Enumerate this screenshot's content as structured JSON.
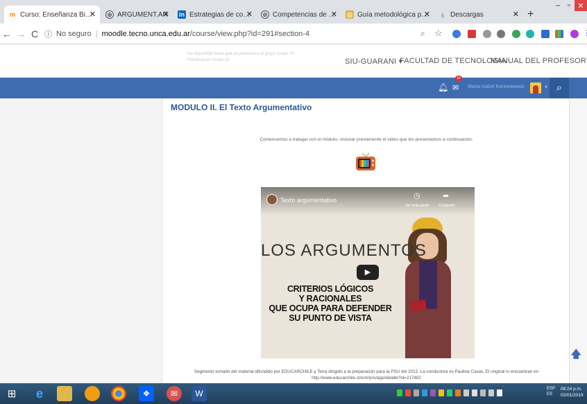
{
  "browser": {
    "tabs": [
      {
        "label": "Curso: Enseñanza Bimod",
        "icon": "moodle-icon",
        "active": true
      },
      {
        "label": "ARGUMENT.AR",
        "icon": "globe-icon"
      },
      {
        "label": "Estrategias de compresi",
        "icon": "linkedin-icon"
      },
      {
        "label": "Competencias de Educac",
        "icon": "globe-icon"
      },
      {
        "label": "Guía metodológica para",
        "icon": "document-icon"
      },
      {
        "label": "Descargas",
        "icon": "download-icon"
      }
    ],
    "url_security": "No seguro",
    "url_host": "moodle.tecno.unca.edu.ar",
    "url_path": "/course/view.php?id=291#section-4"
  },
  "site": {
    "faded_notice_1": "No disponible hasta que se pertenezca al grupo Grupo 10",
    "faded_notice_2": "Planificación Grupo 10",
    "nav": [
      {
        "label": "SIU-GUARANI ▾"
      },
      {
        "label": "FACULTAD DE TECNOLOGIA"
      },
      {
        "label": "MANUAL DEL PROFESOR"
      }
    ],
    "user_name": "María Isabel Korzeniewski",
    "notification_count": "10"
  },
  "content": {
    "module_title": "MODULO II. El Texto Argumentativo",
    "intro_text": "Comencemos a trabajar con el módulo, visionar previamente el video que les presentamos a continuación:",
    "video": {
      "title": "Texto argumentativo",
      "watch_later": "Ver más tarde",
      "share": "Compartir",
      "big_text": "LOS ARGUMENTOS",
      "line1": "CRITERIOS LÓGICOS",
      "line2": "Y RACIONALES",
      "line3": "QUE OCUPA PARA DEFENDER",
      "line4": "SU PUNTO DE VISTA"
    },
    "caption_1": "Segmento tomado del material difundido por EDUCARCHILE y Terra dirigido a la preparación para la PSU del 2012. La conductora es Paulina Casas. El original lo encuentran en",
    "caption_2": "http://www.educarchile.cl/ech/pro/app/detalle?id=217482"
  },
  "taskbar": {
    "lang_1": "ESP",
    "lang_2": "ES",
    "time": "08:24 p.m.",
    "date": "02/01/2019"
  },
  "colors": {
    "header_blue": "#3f6cb0",
    "title_blue": "#2d55a0"
  }
}
